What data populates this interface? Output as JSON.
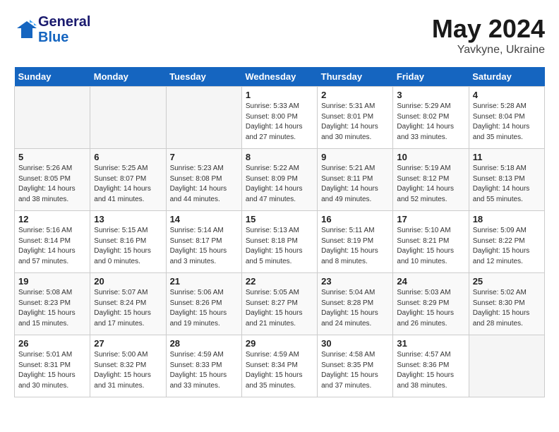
{
  "header": {
    "logo_line1": "General",
    "logo_line2": "Blue",
    "month": "May 2024",
    "location": "Yavkyne, Ukraine"
  },
  "weekdays": [
    "Sunday",
    "Monday",
    "Tuesday",
    "Wednesday",
    "Thursday",
    "Friday",
    "Saturday"
  ],
  "weeks": [
    [
      {
        "day": "",
        "info": ""
      },
      {
        "day": "",
        "info": ""
      },
      {
        "day": "",
        "info": ""
      },
      {
        "day": "1",
        "info": "Sunrise: 5:33 AM\nSunset: 8:00 PM\nDaylight: 14 hours\nand 27 minutes."
      },
      {
        "day": "2",
        "info": "Sunrise: 5:31 AM\nSunset: 8:01 PM\nDaylight: 14 hours\nand 30 minutes."
      },
      {
        "day": "3",
        "info": "Sunrise: 5:29 AM\nSunset: 8:02 PM\nDaylight: 14 hours\nand 33 minutes."
      },
      {
        "day": "4",
        "info": "Sunrise: 5:28 AM\nSunset: 8:04 PM\nDaylight: 14 hours\nand 35 minutes."
      }
    ],
    [
      {
        "day": "5",
        "info": "Sunrise: 5:26 AM\nSunset: 8:05 PM\nDaylight: 14 hours\nand 38 minutes."
      },
      {
        "day": "6",
        "info": "Sunrise: 5:25 AM\nSunset: 8:07 PM\nDaylight: 14 hours\nand 41 minutes."
      },
      {
        "day": "7",
        "info": "Sunrise: 5:23 AM\nSunset: 8:08 PM\nDaylight: 14 hours\nand 44 minutes."
      },
      {
        "day": "8",
        "info": "Sunrise: 5:22 AM\nSunset: 8:09 PM\nDaylight: 14 hours\nand 47 minutes."
      },
      {
        "day": "9",
        "info": "Sunrise: 5:21 AM\nSunset: 8:11 PM\nDaylight: 14 hours\nand 49 minutes."
      },
      {
        "day": "10",
        "info": "Sunrise: 5:19 AM\nSunset: 8:12 PM\nDaylight: 14 hours\nand 52 minutes."
      },
      {
        "day": "11",
        "info": "Sunrise: 5:18 AM\nSunset: 8:13 PM\nDaylight: 14 hours\nand 55 minutes."
      }
    ],
    [
      {
        "day": "12",
        "info": "Sunrise: 5:16 AM\nSunset: 8:14 PM\nDaylight: 14 hours\nand 57 minutes."
      },
      {
        "day": "13",
        "info": "Sunrise: 5:15 AM\nSunset: 8:16 PM\nDaylight: 15 hours\nand 0 minutes."
      },
      {
        "day": "14",
        "info": "Sunrise: 5:14 AM\nSunset: 8:17 PM\nDaylight: 15 hours\nand 3 minutes."
      },
      {
        "day": "15",
        "info": "Sunrise: 5:13 AM\nSunset: 8:18 PM\nDaylight: 15 hours\nand 5 minutes."
      },
      {
        "day": "16",
        "info": "Sunrise: 5:11 AM\nSunset: 8:19 PM\nDaylight: 15 hours\nand 8 minutes."
      },
      {
        "day": "17",
        "info": "Sunrise: 5:10 AM\nSunset: 8:21 PM\nDaylight: 15 hours\nand 10 minutes."
      },
      {
        "day": "18",
        "info": "Sunrise: 5:09 AM\nSunset: 8:22 PM\nDaylight: 15 hours\nand 12 minutes."
      }
    ],
    [
      {
        "day": "19",
        "info": "Sunrise: 5:08 AM\nSunset: 8:23 PM\nDaylight: 15 hours\nand 15 minutes."
      },
      {
        "day": "20",
        "info": "Sunrise: 5:07 AM\nSunset: 8:24 PM\nDaylight: 15 hours\nand 17 minutes."
      },
      {
        "day": "21",
        "info": "Sunrise: 5:06 AM\nSunset: 8:26 PM\nDaylight: 15 hours\nand 19 minutes."
      },
      {
        "day": "22",
        "info": "Sunrise: 5:05 AM\nSunset: 8:27 PM\nDaylight: 15 hours\nand 21 minutes."
      },
      {
        "day": "23",
        "info": "Sunrise: 5:04 AM\nSunset: 8:28 PM\nDaylight: 15 hours\nand 24 minutes."
      },
      {
        "day": "24",
        "info": "Sunrise: 5:03 AM\nSunset: 8:29 PM\nDaylight: 15 hours\nand 26 minutes."
      },
      {
        "day": "25",
        "info": "Sunrise: 5:02 AM\nSunset: 8:30 PM\nDaylight: 15 hours\nand 28 minutes."
      }
    ],
    [
      {
        "day": "26",
        "info": "Sunrise: 5:01 AM\nSunset: 8:31 PM\nDaylight: 15 hours\nand 30 minutes."
      },
      {
        "day": "27",
        "info": "Sunrise: 5:00 AM\nSunset: 8:32 PM\nDaylight: 15 hours\nand 31 minutes."
      },
      {
        "day": "28",
        "info": "Sunrise: 4:59 AM\nSunset: 8:33 PM\nDaylight: 15 hours\nand 33 minutes."
      },
      {
        "day": "29",
        "info": "Sunrise: 4:59 AM\nSunset: 8:34 PM\nDaylight: 15 hours\nand 35 minutes."
      },
      {
        "day": "30",
        "info": "Sunrise: 4:58 AM\nSunset: 8:35 PM\nDaylight: 15 hours\nand 37 minutes."
      },
      {
        "day": "31",
        "info": "Sunrise: 4:57 AM\nSunset: 8:36 PM\nDaylight: 15 hours\nand 38 minutes."
      },
      {
        "day": "",
        "info": ""
      }
    ]
  ]
}
